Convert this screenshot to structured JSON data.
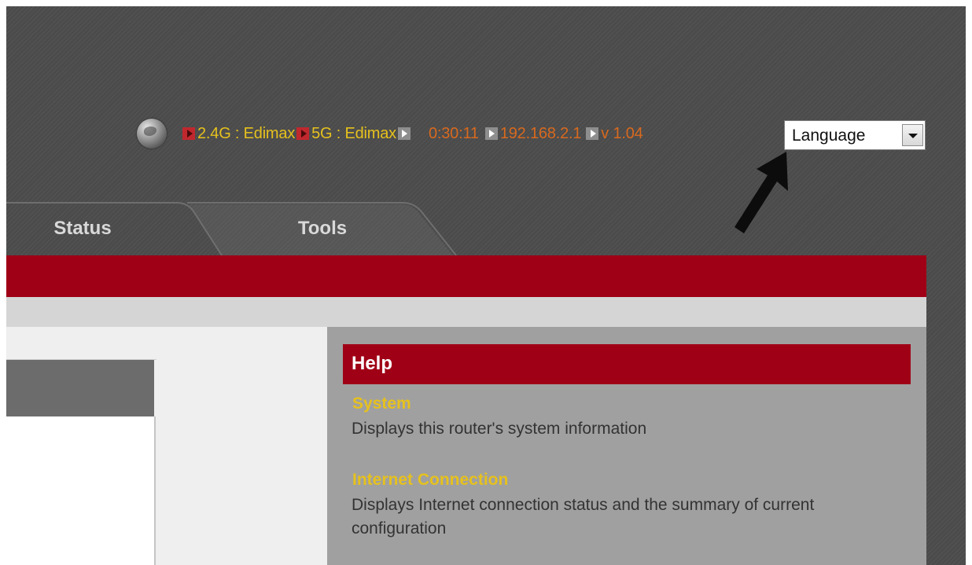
{
  "status_bar": {
    "globe_icon": "globe-icon",
    "band_24g": "2.4G : Edimax",
    "band_5g": "5G : Edimax",
    "uptime": "0:30:11",
    "ip_address": "192.168.2.1",
    "version": "v 1.04",
    "colors": {
      "ssid_text": "#e6c11d",
      "info_text": "#d8691e"
    }
  },
  "language_select": {
    "value": "Language",
    "icon": "chevron-down-icon"
  },
  "tabs": [
    {
      "label": "Status"
    },
    {
      "label": "Tools"
    }
  ],
  "help": {
    "title": "Help",
    "items": [
      {
        "topic": "System",
        "description": "Displays this router's system information"
      },
      {
        "topic": "Internet Connection",
        "description": "Displays Internet connection status and the summary of current configuration"
      }
    ]
  },
  "theme": {
    "brand_red": "#a00016",
    "panel_grey": "#a0a0a0",
    "background": "#4b4b4b"
  }
}
